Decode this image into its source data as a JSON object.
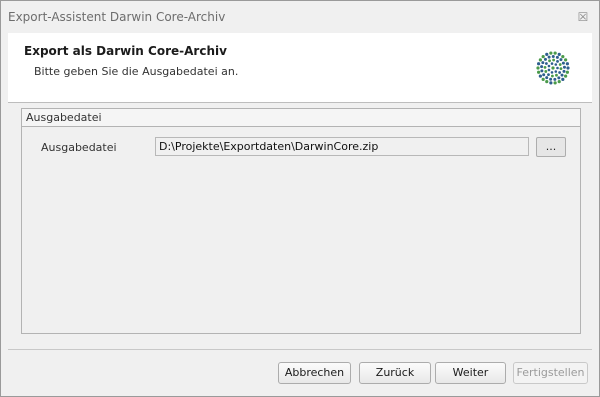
{
  "window": {
    "title": "Export-Assistent Darwin Core-Archiv",
    "close_glyph": "☒"
  },
  "header": {
    "title": "Export als Darwin Core-Archiv",
    "subtitle": "Bitte geben Sie die Ausgabedatei an.",
    "logo_icon": "darwin-core-logo-icon"
  },
  "group": {
    "title": "Ausgabedatei",
    "field_label": "Ausgabedatei",
    "field_value": "D:\\Projekte\\Exportdaten\\DarwinCore.zip",
    "browse_label": "..."
  },
  "footer": {
    "cancel_label": "Abbrechen",
    "back_label": "Zurück",
    "next_label": "Weiter",
    "finish_label": "Fertigstellen"
  },
  "colors": {
    "logo_green": "#4a9a4a",
    "logo_blue": "#2e5e8e"
  }
}
